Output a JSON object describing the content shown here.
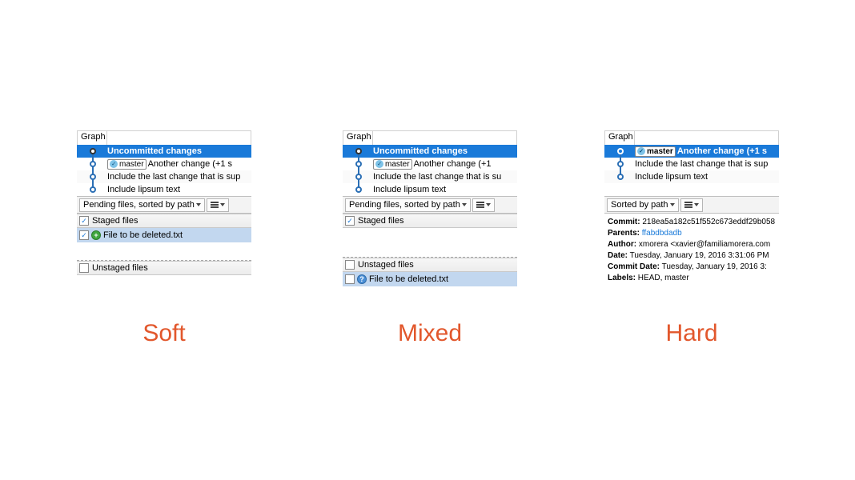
{
  "graphHeader": "Graph",
  "commits": {
    "uncommitted": "Uncommitted changes",
    "branch": "master",
    "another_soft": "Another change (+1 s",
    "another_mixed": "Another change (+1",
    "another_hard": "Another change (+1 s",
    "include_last_soft": "Include the last change that is sup",
    "include_last_mixed": "Include the last change that is su",
    "include_last_hard": "Include the last change that is sup",
    "lipsum": "Include lipsum text"
  },
  "toolbar": {
    "pending_sorted": "Pending files, sorted by path",
    "sorted_by_path": "Sorted by path"
  },
  "sections": {
    "staged": "Staged files",
    "unstaged": "Unstaged files"
  },
  "file": "File to be deleted.txt",
  "captions": {
    "soft": "Soft",
    "mixed": "Mixed",
    "hard": "Hard"
  },
  "meta": {
    "commit_label": "Commit:",
    "commit_value": "218ea5a182c51f552c673eddf29b058",
    "parents_label": "Parents:",
    "parents_value": "ffabdbdadb",
    "author_label": "Author:",
    "author_value": "xmorera <xavier@familiamorera.com",
    "date_label": "Date:",
    "date_value": "Tuesday, January 19, 2016 3:31:06 PM",
    "commit_date_label": "Commit Date:",
    "commit_date_value": "Tuesday, January 19, 2016 3:",
    "labels_label": "Labels:",
    "labels_value": "HEAD, master"
  }
}
